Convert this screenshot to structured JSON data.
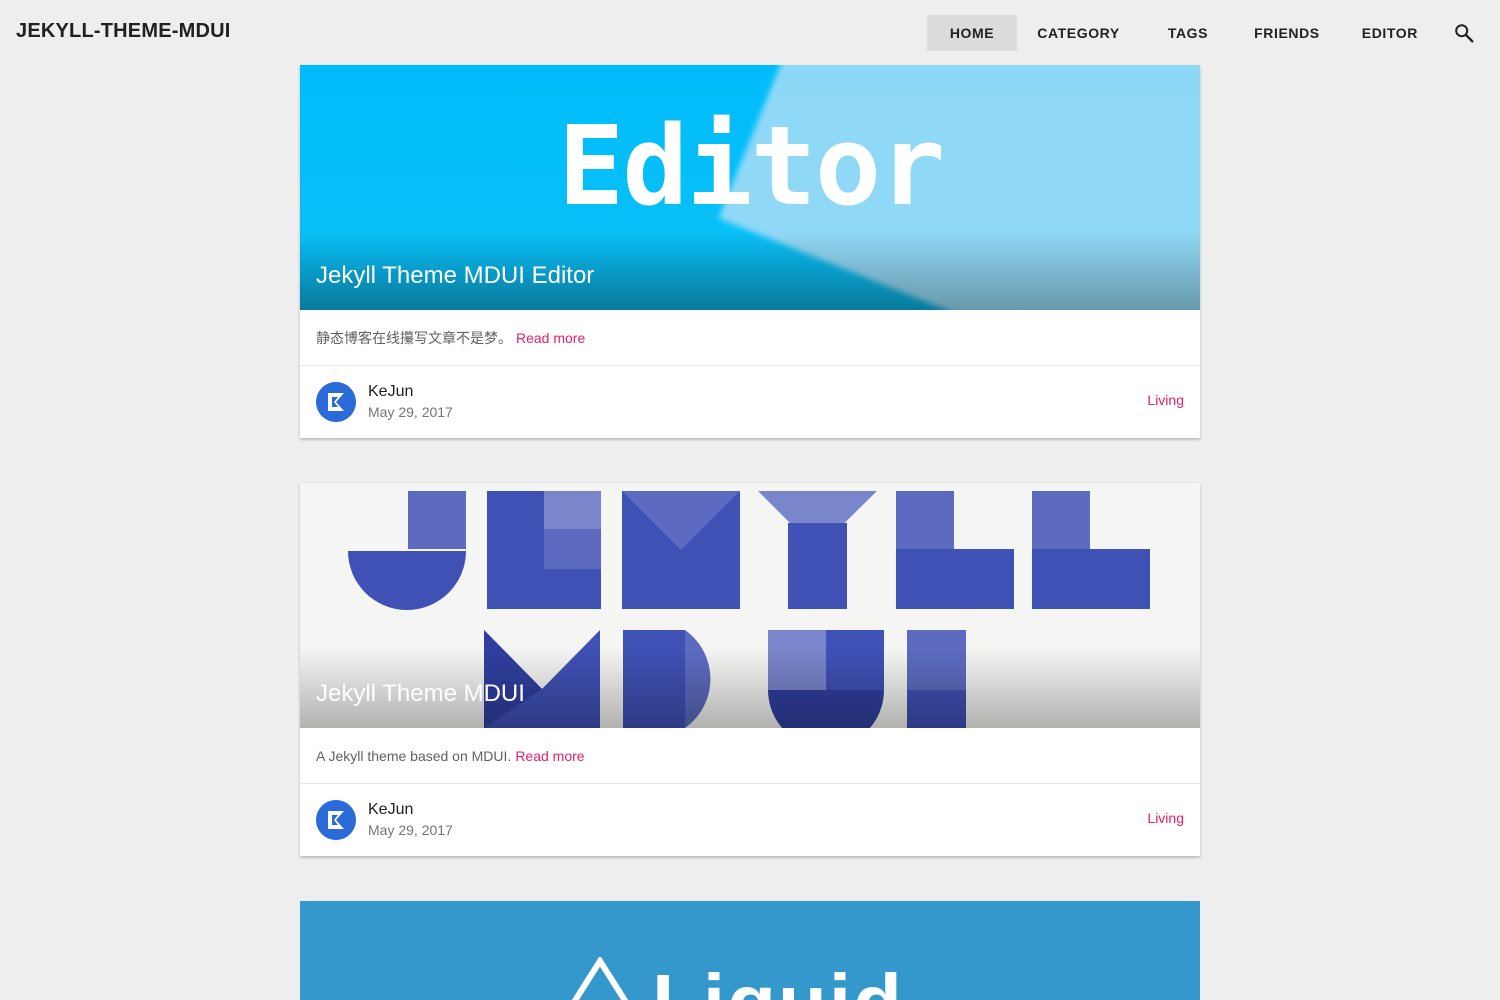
{
  "app": {
    "brand": "JEKYLL-THEME-MDUI"
  },
  "nav": {
    "tabs": [
      {
        "label": "HOME",
        "active": true
      },
      {
        "label": "CATEGORY",
        "active": false
      },
      {
        "label": "TAGS",
        "active": false
      },
      {
        "label": "FRIENDS",
        "active": false
      },
      {
        "label": "EDITOR",
        "active": false
      }
    ],
    "search_icon": "search-icon"
  },
  "posts": [
    {
      "title": "Jekyll Theme MDUI Editor",
      "banner_text": "Editor",
      "excerpt": "静态博客在线攥写文章不是梦。",
      "read_more": "Read more",
      "author": "KeJun",
      "date": "May 29, 2017",
      "category": "Living"
    },
    {
      "title": "Jekyll Theme MDUI",
      "excerpt": "A Jekyll theme based on MDUI.",
      "read_more": "Read more",
      "author": "KeJun",
      "date": "May 29, 2017",
      "category": "Living"
    },
    {
      "banner_text": "Liquid"
    }
  ],
  "colors": {
    "accent": "#e91e63",
    "appbar": "#eeeeee",
    "editor_banner": "#00bcfa",
    "jekyll_blue": "#3f51b5",
    "liquid_banner": "#3498cc"
  }
}
